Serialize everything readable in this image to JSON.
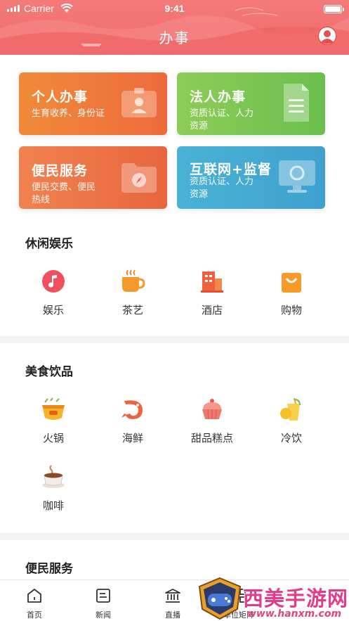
{
  "status_bar": {
    "carrier": "Carrier",
    "time": "9:41"
  },
  "header": {
    "title": "办事",
    "user_icon": "user-avatar-icon"
  },
  "cards": [
    {
      "title": "个人办事",
      "subtitle": "生育收养、身份证",
      "icon": "id-card-icon"
    },
    {
      "title": "法人办事",
      "subtitle": "资质认证、人力资源",
      "icon": "document-icon"
    },
    {
      "title": "便民服务",
      "subtitle": "便民交费、便民热线",
      "icon": "folder-compass-icon"
    },
    {
      "title": "互联网+监督",
      "subtitle": "资质认证、人力资源",
      "icon": "monitor-icon"
    }
  ],
  "leisure": {
    "title": "休闲娱乐",
    "items": [
      {
        "label": "娱乐",
        "icon": "music-note-icon"
      },
      {
        "label": "茶艺",
        "icon": "tea-cup-icon"
      },
      {
        "label": "酒店",
        "icon": "hotel-building-icon"
      },
      {
        "label": "购物",
        "icon": "shopping-bag-icon"
      }
    ]
  },
  "food": {
    "title": "美食饮品",
    "items": [
      {
        "label": "火锅",
        "icon": "hotpot-icon"
      },
      {
        "label": "海鲜",
        "icon": "shrimp-icon"
      },
      {
        "label": "甜品糕点",
        "icon": "cupcake-icon"
      },
      {
        "label": "冷饮",
        "icon": "cold-drink-icon"
      },
      {
        "label": "咖啡",
        "icon": "coffee-icon"
      }
    ]
  },
  "services": {
    "title": "便民服务"
  },
  "tabbar": {
    "items": [
      {
        "label": "首页",
        "icon": "home-icon"
      },
      {
        "label": "新闻",
        "icon": "news-icon"
      },
      {
        "label": "直播",
        "icon": "institution-icon"
      },
      {
        "label": "单位矩阵",
        "icon": "grid-icon"
      }
    ]
  },
  "watermark": {
    "brand": "西美手游网",
    "url": "www.hanxm.com"
  },
  "colors": {
    "header": "#f06a6a",
    "accent_orange": "#ee6a3c",
    "accent_green": "#6bbf4e",
    "accent_blue": "#3fa0cf"
  }
}
